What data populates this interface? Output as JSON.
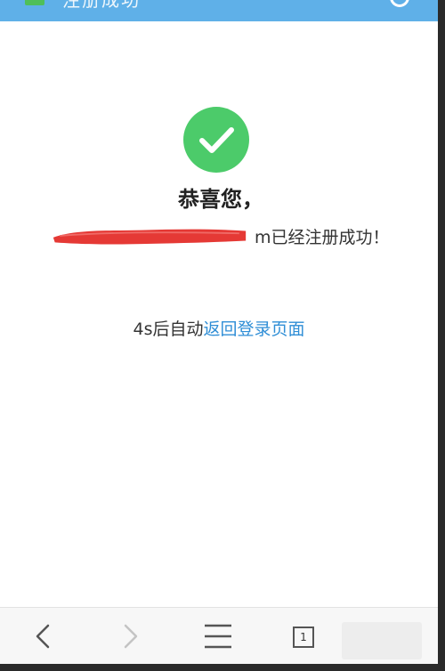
{
  "header": {
    "title": "注册成功",
    "page_icon": "page-icon",
    "refresh_icon": "refresh-icon"
  },
  "main": {
    "success_icon": "check-circle-icon",
    "congrats": "恭喜您，",
    "registered_suffix": "m已经注册成功！",
    "countdown": "4s后自动",
    "return_link": "返回登录页面"
  },
  "bottom_nav": {
    "back_icon": "chevron-left-icon",
    "forward_icon": "chevron-right-icon",
    "menu_icon": "menu-icon",
    "tab_count": "1"
  },
  "colors": {
    "top_bar": "#5fb0e8",
    "success_green": "#4ccb6a",
    "link_blue": "#2f8ed6",
    "redaction_red": "#e53935"
  }
}
